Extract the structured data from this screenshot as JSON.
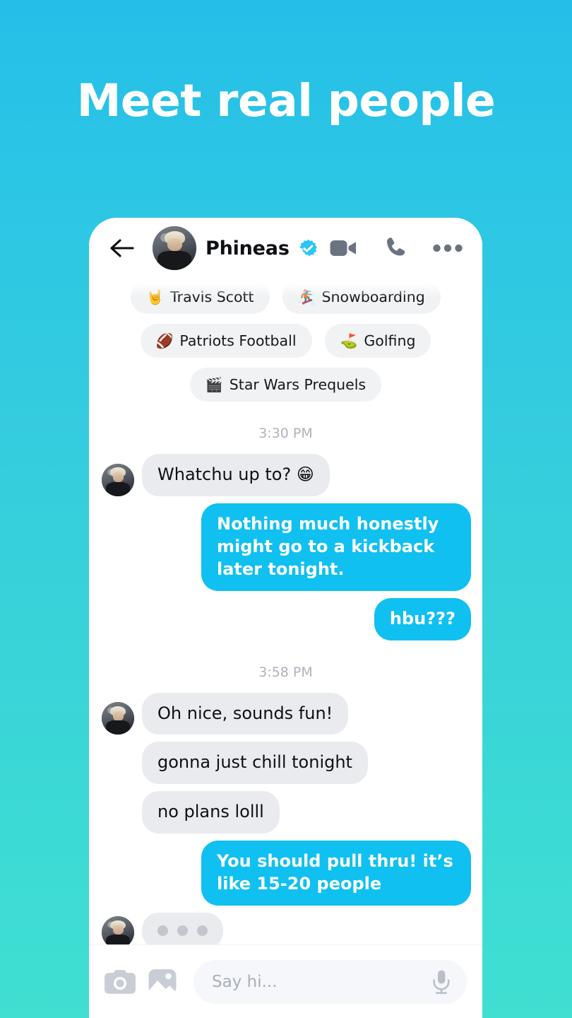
{
  "hero": {
    "headline": "Meet real people"
  },
  "theme": {
    "bg_top": "#25BEE8",
    "bg_bottom": "#40DFD2",
    "accent_blue": "#0FC0F0",
    "bubble_grey": "#E9EBEE",
    "tag_grey": "#F1F2F4",
    "verified_blue": "#29C5F6",
    "icon_grey": "#6B7280",
    "placeholder_grey": "#A9B0BA"
  },
  "header": {
    "back_icon": "arrow-left-icon",
    "avatar_alt": "phineas-avatar",
    "name": "Phineas",
    "verified_badge": "verified-badge-icon",
    "actions": [
      {
        "name": "video-call-icon",
        "label": "Video call"
      },
      {
        "name": "voice-call-icon",
        "label": "Voice call"
      },
      {
        "name": "more-options-icon",
        "label": "More options"
      }
    ]
  },
  "interest_tags": [
    {
      "emoji": "🤘",
      "label": "Travis Scott"
    },
    {
      "emoji": "🏂",
      "label": "Snowboarding"
    },
    {
      "emoji": "🏈",
      "label": "Patriots Football"
    },
    {
      "emoji": "⛳",
      "label": "Golfing"
    },
    {
      "emoji": "🎬",
      "label": "Star Wars Prequels"
    }
  ],
  "conversation": [
    {
      "kind": "timestamp",
      "text": "3:30 PM"
    },
    {
      "kind": "received",
      "text": "Whatchu up to? 😁",
      "avatar": true
    },
    {
      "kind": "sent",
      "text": "Nothing much honestly might go to a kickback later tonight."
    },
    {
      "kind": "sent",
      "text": "hbu???"
    },
    {
      "kind": "timestamp",
      "text": "3:58 PM"
    },
    {
      "kind": "received",
      "text": "Oh nice, sounds fun!",
      "avatar": true
    },
    {
      "kind": "received",
      "text": "gonna just chill tonight",
      "avatar": false
    },
    {
      "kind": "received",
      "text": "no plans lolll",
      "avatar": false
    },
    {
      "kind": "sent",
      "text": "You should pull thru! it’s like 15-20 people"
    },
    {
      "kind": "typing",
      "text": "",
      "avatar": true
    }
  ],
  "composer": {
    "camera_icon": "camera-icon",
    "gallery_icon": "photo-gallery-icon",
    "input_value": "",
    "input_placeholder": "Say hi...",
    "mic_icon": "microphone-icon"
  }
}
